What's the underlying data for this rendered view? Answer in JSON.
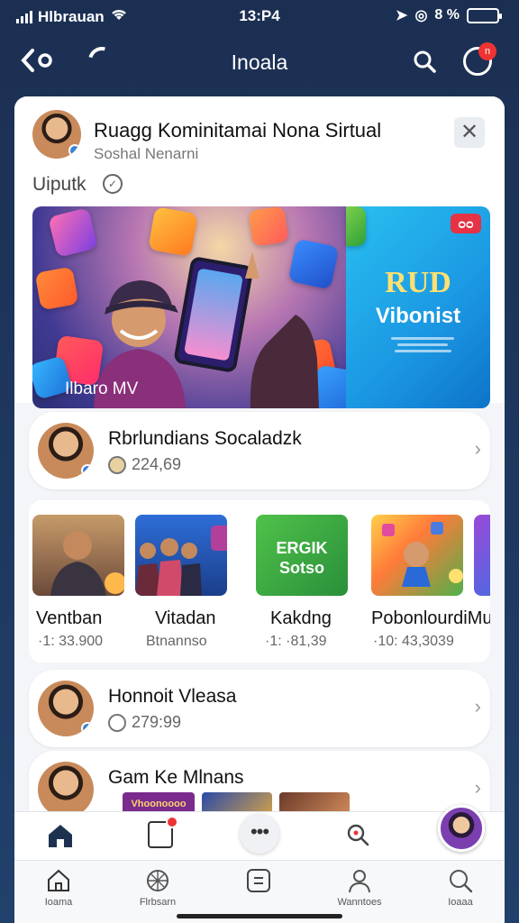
{
  "status_bar": {
    "carrier": "Hlbrauan",
    "time": "13:P4",
    "battery_text": "8 %",
    "battery_level": 0.9
  },
  "nav": {
    "title": "Inoala",
    "back_icon": "chevron-left-icon",
    "refresh_icon": "refresh-icon",
    "search_icon": "search-icon",
    "notify_icon": "notification-icon",
    "notify_badge": "n"
  },
  "header": {
    "title": "Ruagg Kominitamai Nona Sirtual",
    "subtitle": "Soshal Nenarni",
    "close_icon": "close-icon"
  },
  "section": {
    "label": "Uiputk"
  },
  "banner": {
    "caption": "Ilbaro MV",
    "badge": "ᴑᴑ",
    "title": "RUD",
    "subtitle": "Vibonist"
  },
  "rows": [
    {
      "title": "Rbrlundians Socaladzk",
      "meta": "224,69"
    },
    {
      "title": "Honnoit Vleasa",
      "meta": "279:99"
    },
    {
      "title": "Gam Ke Mlnans",
      "meta": ""
    }
  ],
  "thumbnails": [
    {
      "label": "Ventban",
      "sub": "·1: 33.900"
    },
    {
      "label": "Vitadan",
      "sub": "Btnannso"
    },
    {
      "label": "Kakdng",
      "sub": "·1: ·81,39"
    },
    {
      "label": "PobonlourdiMu",
      "sub": "·10: 43,3039"
    }
  ],
  "thumbnail_green_text": "ERGIK Sotso",
  "mini_thumb_text": "Vhoonoooo",
  "tabs": [
    {
      "label": "Ioama",
      "icon": "home-icon"
    },
    {
      "label": "Flrbsarn",
      "icon": "compass-icon"
    },
    {
      "label": "",
      "icon": "inbox-icon"
    },
    {
      "label": "Wanntoes",
      "icon": "profile-icon"
    },
    {
      "label": "Ioaaa",
      "icon": "search-icon"
    }
  ],
  "colors": {
    "background": "#1b2f52",
    "accent_red": "#e53244",
    "banner_blue": "#1b97e2",
    "banner_gold": "#ffe070",
    "verified_blue": "#3a82d6"
  }
}
